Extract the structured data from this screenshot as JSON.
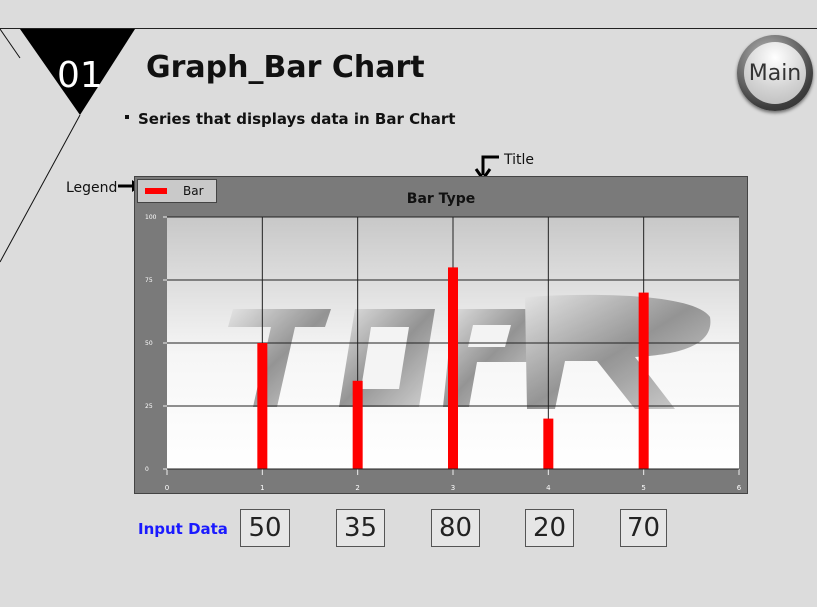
{
  "header": {
    "number": "01",
    "title": "Graph_Bar Chart",
    "main_label": "Main"
  },
  "subtitle": "Series that displays data in Bar Chart",
  "annotations": {
    "legend": "Legend",
    "title": "Title"
  },
  "chart_data": {
    "type": "bar",
    "title": "Bar Type",
    "legend": [
      "Bar"
    ],
    "series": [
      {
        "name": "Bar",
        "x": [
          1,
          2,
          3,
          4,
          5
        ],
        "values": [
          50,
          35,
          80,
          20,
          70
        ],
        "color": "#ff0000"
      }
    ],
    "xlim": [
      0,
      6
    ],
    "ylim": [
      0,
      100
    ],
    "x_ticks": [
      "0",
      "1",
      "2",
      "3",
      "4",
      "5",
      "6"
    ],
    "y_ticks": [
      "0",
      "25",
      "50",
      "75",
      "100"
    ],
    "grid": true,
    "legend_position": "top-left",
    "watermark": "TOP R"
  },
  "input": {
    "label": "Input Data",
    "values": [
      "50",
      "35",
      "80",
      "20",
      "70"
    ]
  }
}
